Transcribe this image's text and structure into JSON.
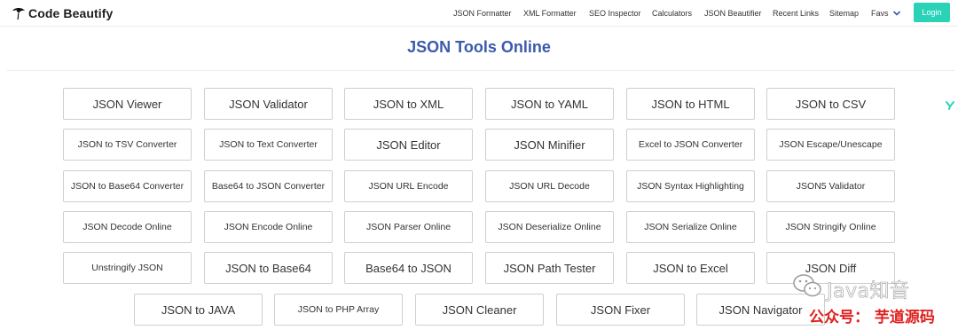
{
  "brand": {
    "name": "Code Beautify"
  },
  "nav": {
    "items": [
      "JSON Formatter",
      "XML Formatter",
      "SEO Inspector",
      "Calculators",
      "JSON Beautifier",
      "Recent Links",
      "Sitemap"
    ],
    "favs_label": "Favs"
  },
  "login_label": "Login",
  "page": {
    "title": "JSON Tools Online"
  },
  "tools": [
    "JSON Viewer",
    "JSON Validator",
    "JSON to XML",
    "JSON to YAML",
    "JSON to HTML",
    "JSON to CSV",
    "JSON to TSV Converter",
    "JSON to Text Converter",
    "JSON Editor",
    "JSON Minifier",
    "Excel to JSON Converter",
    "JSON Escape/Unescape",
    "JSON to Base64 Converter",
    "Base64 to JSON Converter",
    "JSON URL Encode",
    "JSON URL Decode",
    "JSON Syntax Highlighting",
    "JSON5 Validator",
    "JSON Decode Online",
    "JSON Encode Online",
    "JSON Parser Online",
    "JSON Deserialize Online",
    "JSON Serialize Online",
    "JSON Stringify Online",
    "Unstringify JSON",
    "JSON to Base64",
    "Base64 to JSON",
    "JSON Path Tester",
    "JSON to Excel",
    "JSON Diff",
    "JSON to JAVA",
    "JSON to PHP Array",
    "JSON Cleaner",
    "JSON Fixer",
    "JSON Navigator"
  ],
  "watermark": {
    "brand": "Java知音",
    "account": "公众号： 芋道源码"
  },
  "icons": {
    "logo": "code-beautify-logo-icon",
    "favs": "chevron-down-icon",
    "side": "side-badge-icon",
    "watermark": "wechat-icon"
  },
  "colors": {
    "accent": "#2ad3b8",
    "title": "#3b5aad",
    "watermark_account": "#e0201f"
  }
}
